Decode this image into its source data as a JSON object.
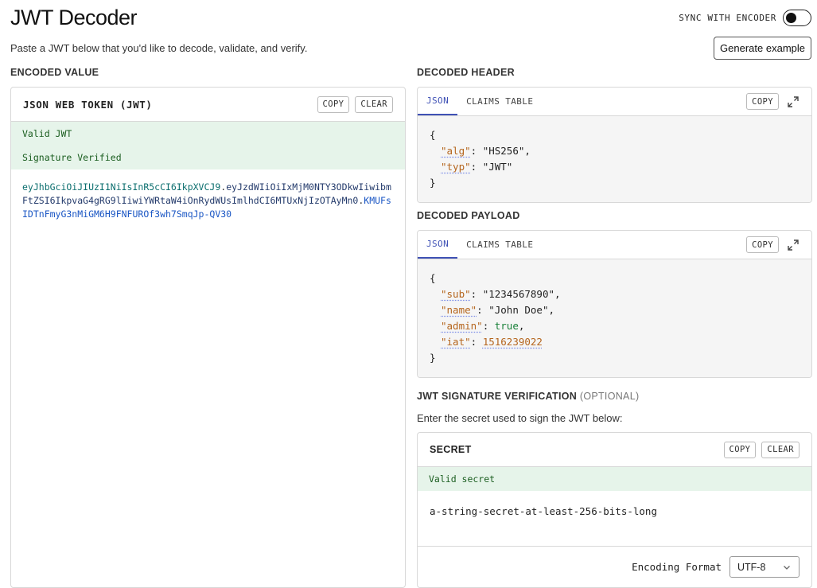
{
  "header": {
    "title": "JWT Decoder",
    "subtitle": "Paste a JWT below that you'd like to decode, validate, and verify.",
    "sync_label": "SYNC WITH ENCODER",
    "sync_enabled": false,
    "generate_label": "Generate example"
  },
  "encoded": {
    "section_label": "ENCODED VALUE",
    "panel_title": "JSON WEB TOKEN (JWT)",
    "copy_label": "COPY",
    "clear_label": "CLEAR",
    "status_valid": "Valid JWT",
    "status_signature": "Signature Verified",
    "token_header": "eyJhbGciOiJIUzI1NiIsInR5cCI6IkpXVCJ9",
    "token_payload": "eyJzdWIiOiIxMjM0NTY3ODkwIiwibmFtZSI6IkpvaG4gRG9lIiwiYWRtaW4iOnRydWUsImlhdCI6MTUxNjIzOTAyMn0",
    "token_signature": "KMUFsIDTnFmyG3nMiGM6H9FNFUROf3wh7SmqJp-QV30",
    "dot": "."
  },
  "decoded_header": {
    "section_label": "DECODED HEADER",
    "tabs": [
      "JSON",
      "CLAIMS TABLE"
    ],
    "active_tab": "JSON",
    "copy_label": "COPY",
    "alg_key": "\"alg\"",
    "alg_value": "\"HS256\"",
    "typ_key": "\"typ\"",
    "typ_value": "\"JWT\""
  },
  "decoded_payload": {
    "section_label": "DECODED PAYLOAD",
    "tabs": [
      "JSON",
      "CLAIMS TABLE"
    ],
    "active_tab": "JSON",
    "copy_label": "COPY",
    "sub_key": "\"sub\"",
    "sub_value": "\"1234567890\"",
    "name_key": "\"name\"",
    "name_value": "\"John Doe\"",
    "admin_key": "\"admin\"",
    "admin_value": "true",
    "iat_key": "\"iat\"",
    "iat_value": "1516239022"
  },
  "verification": {
    "section_label": "JWT SIGNATURE VERIFICATION",
    "optional_label": "(OPTIONAL)",
    "helper_text": "Enter the secret used to sign the JWT below:",
    "panel_title": "SECRET",
    "copy_label": "COPY",
    "clear_label": "CLEAR",
    "status": "Valid secret",
    "secret_value": "a-string-secret-at-least-256-bits-long",
    "encoding_label": "Encoding Format",
    "encoding_value": "UTF-8"
  },
  "icons": [
    "expand-icon",
    "chevron-down-icon"
  ],
  "colors": {
    "valid_bg": "#e6f4ea",
    "valid_text": "#1b5e20",
    "accent": "#3f51b5"
  }
}
